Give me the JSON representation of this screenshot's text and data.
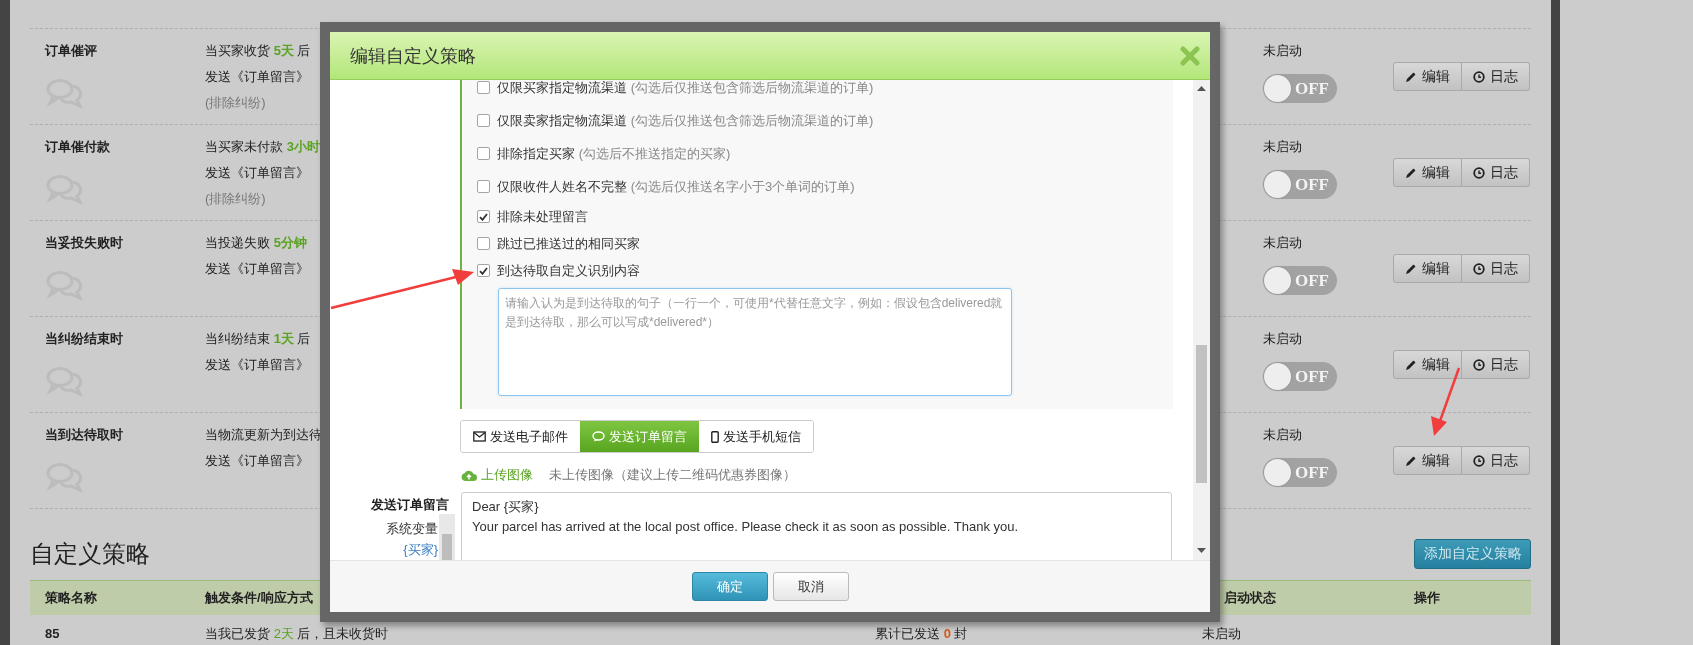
{
  "rules": [
    {
      "name": "订单催评",
      "lines": [
        "当买家收货 **5天** 后",
        "发送《订单留言》"
      ],
      "note": "(排除纠纷)",
      "status": "未启动",
      "enabled": false,
      "toggle": "OFF",
      "edit": "编辑",
      "log": "日志"
    },
    {
      "name": "订单催付款",
      "lines": [
        "当买家未付款 **3小时**",
        "发送《订单留言》"
      ],
      "note": "(排除纠纷)",
      "status": "未启动",
      "enabled": false,
      "toggle": "OFF",
      "edit": "编辑",
      "log": "日志"
    },
    {
      "name": "当妥投失败时",
      "lines": [
        "当投递失败 **5分钟**",
        "发送《订单留言》"
      ],
      "status": "未启动",
      "enabled": false,
      "toggle": "OFF",
      "edit": "编辑",
      "log": "日志"
    },
    {
      "name": "当纠纷结束时",
      "lines": [
        "当纠纷结束 **1天** 后",
        "发送《订单留言》"
      ],
      "status": "未启动",
      "enabled": false,
      "toggle": "OFF",
      "edit": "编辑",
      "log": "日志"
    },
    {
      "name": "当到达待取时",
      "lines": [
        "当物流更新为到达待",
        "发送《订单留言》"
      ],
      "status": "未启动",
      "enabled": false,
      "toggle": "OFF",
      "edit": "编辑",
      "log": "日志"
    }
  ],
  "custom": {
    "title": "自定义策略",
    "add_button": "添加自定义策略",
    "columns": [
      "策略名称",
      "触发条件/响应方式",
      "启动状态",
      "操作"
    ],
    "rows": [
      {
        "name": "85",
        "condition": "当我已发货 **2天** 后，且未收货时",
        "sent": "累计已发送 **0** 封",
        "status": "未启动"
      }
    ]
  },
  "modal": {
    "title": "编辑自定义策略",
    "options": [
      {
        "label": "仅限买家指定物流渠道",
        "hint": "(勾选后仅推送包含筛选后物流渠道的订单)",
        "checked": false
      },
      {
        "label": "仅限卖家指定物流渠道",
        "hint": "(勾选后仅推送包含筛选后物流渠道的订单)",
        "checked": false
      },
      {
        "label": "排除指定买家",
        "hint": "(勾选后不推送指定的买家)",
        "checked": false
      },
      {
        "label": "仅限收件人姓名不完整",
        "hint": "(勾选后仅推送名字小于3个单词的订单)",
        "checked": false
      },
      {
        "label": "排除未处理留言",
        "checked": true
      },
      {
        "label": "跳过已推送过的相同买家",
        "checked": false
      },
      {
        "label": "到达待取自定义识别内容",
        "checked": true
      }
    ],
    "pattern_field": {
      "placeholder": "请输入认为是到达待取的句子（一行一个，可使用*代替任意文字，例如：假设包含delivered就是到达待取，那么可以写成*delivered*）"
    },
    "channels": [
      {
        "label": "发送电子邮件",
        "selected": false
      },
      {
        "label": "发送订单留言",
        "selected": true
      },
      {
        "label": "发送手机短信",
        "selected": false
      }
    ],
    "upload": {
      "link": "上传图像",
      "status": "未上传图像（建议上传二维码优惠券图像）"
    },
    "message": {
      "label": "发送订单留言",
      "variables_label": "系统变量",
      "variables": [
        "{买家}"
      ],
      "lines": [
        "Dear {买家}",
        "Your parcel has arrived at the local post office. Please check it as soon as possible. Thank you."
      ]
    },
    "buttons": {
      "confirm": "确定",
      "cancel": "取消"
    }
  }
}
